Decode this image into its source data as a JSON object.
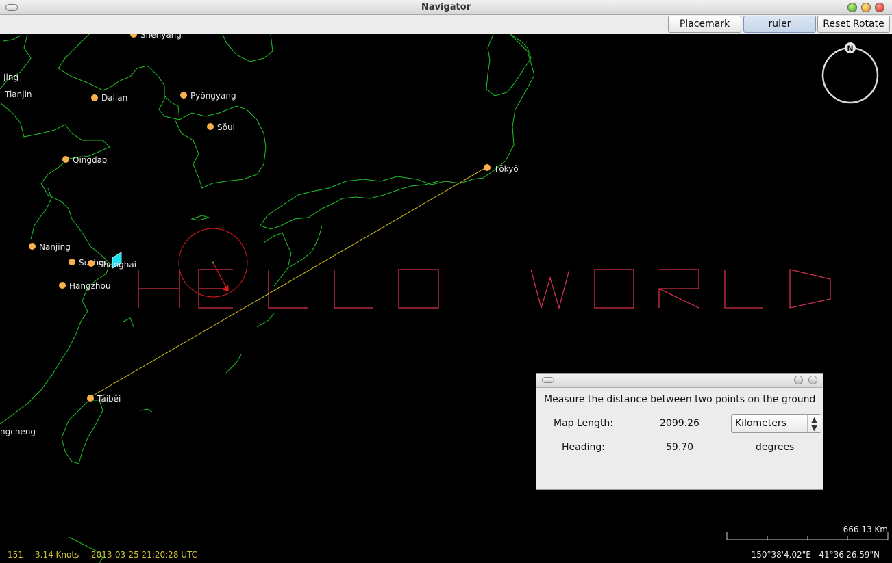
{
  "window": {
    "title": "Navigator"
  },
  "toolbar": {
    "placemark_label": "Placemark",
    "ruler_label": "ruler",
    "reset_rotate_label": "Reset Rotate"
  },
  "compass": {
    "north_label": "N"
  },
  "map": {
    "overlay_text": "HELLO WORLD",
    "cities": [
      "Shenyang",
      "Jing",
      "Tianjin",
      "Dalian",
      "Pyŏngyang",
      "Sŏul",
      "Qingdao",
      "Tōkyō",
      "Nanjing",
      "Suzhou",
      "Shanghai",
      "Hangzhou",
      "Táiběi",
      "ngcheng"
    ],
    "colors": {
      "coastline": "#22c22a",
      "overlay": "#d6304e",
      "ruler_line": "#d8c11c",
      "city_marker": "#f7b04a",
      "circle": "#d81c1c",
      "status": "#d2c43a"
    }
  },
  "status_bar": {
    "value1": "151",
    "speed": "3.14 Knots",
    "timestamp": "2013-03-25 21:20:28 UTC"
  },
  "scale_bar": {
    "label": "666.13 Km"
  },
  "coordinates": {
    "lon": "150°38'4.02\"E",
    "lat": "41°36'26.59\"N"
  },
  "measure_panel": {
    "description": "Measure the distance between two points on the ground",
    "map_length_label": "Map Length:",
    "map_length_value": "2099.26",
    "unit_selected": "Kilometers",
    "heading_label": "Heading:",
    "heading_value": "59.70",
    "heading_unit": "degrees"
  }
}
